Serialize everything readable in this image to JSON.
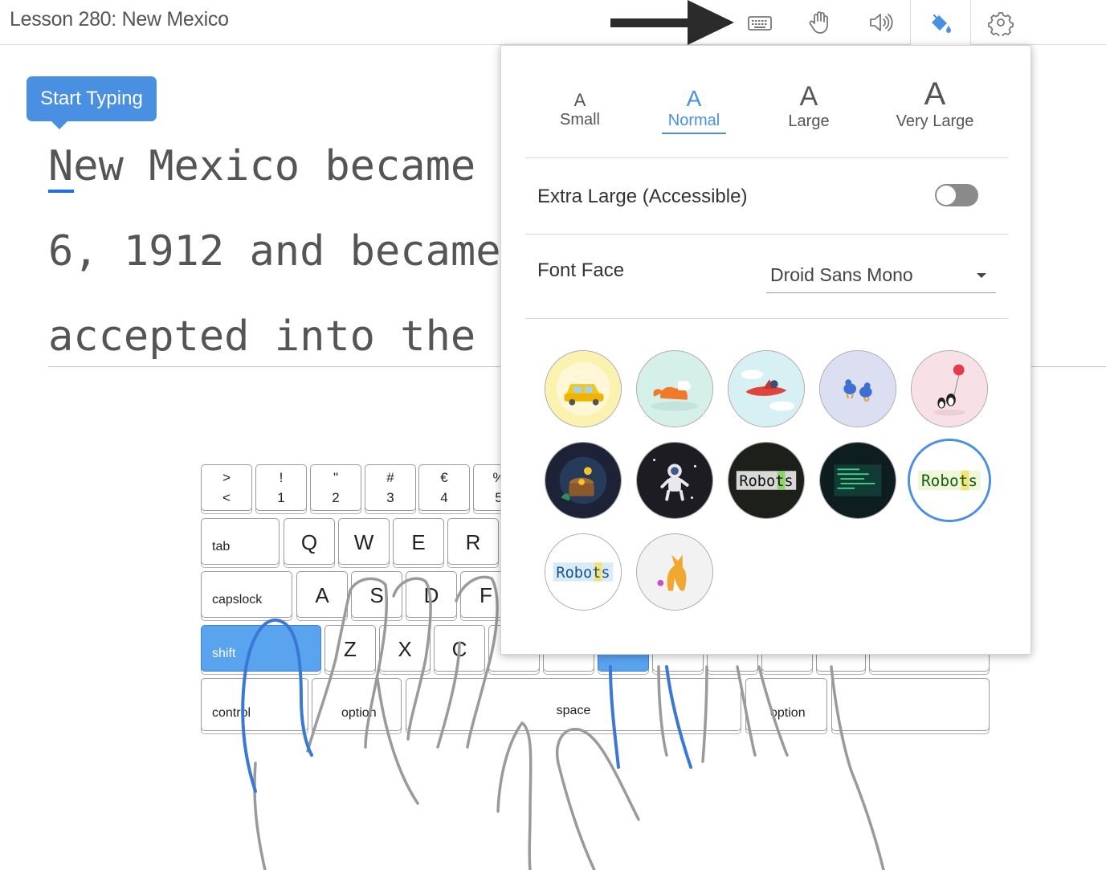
{
  "header": {
    "lesson_title": "Lesson 280: New Mexico",
    "toolbar": [
      {
        "id": "keyboard",
        "icon": "keyboard-icon"
      },
      {
        "id": "hands",
        "icon": "hand-icon"
      },
      {
        "id": "sound",
        "icon": "speaker-icon"
      },
      {
        "id": "theme",
        "icon": "paint-bucket-icon",
        "active": true
      },
      {
        "id": "settings",
        "icon": "gear-icon"
      }
    ]
  },
  "lesson": {
    "start_label": "Start Typing",
    "lines": [
      "New Mexico became",
      "6, 1912 and became",
      "accepted into the"
    ]
  },
  "keyboard": {
    "row_numbers": [
      {
        "top": ">",
        "bottom": "<"
      },
      {
        "top": "!",
        "bottom": "1"
      },
      {
        "top": "\"",
        "bottom": "2"
      },
      {
        "top": "#",
        "bottom": "3"
      },
      {
        "top": "€",
        "bottom": "4"
      },
      {
        "top": "%",
        "bottom": "5"
      }
    ],
    "tab": "tab",
    "row_top": [
      "Q",
      "W",
      "E",
      "R"
    ],
    "capslock": "capslock",
    "row_home": [
      "A",
      "S",
      "D",
      "F"
    ],
    "shift": "shift",
    "row_bottom": [
      "Z",
      "X",
      "C"
    ],
    "control": "control",
    "option_left": "option",
    "space": "space",
    "option_right": "option"
  },
  "popup": {
    "sizes": [
      {
        "glyph": "A",
        "label": "Small"
      },
      {
        "glyph": "A",
        "label": "Normal"
      },
      {
        "glyph": "A",
        "label": "Large"
      },
      {
        "glyph": "A",
        "label": "Very Large"
      }
    ],
    "selected_size": "Normal",
    "extra_large_label": "Extra Large (Accessible)",
    "extra_large_enabled": false,
    "font_face_label": "Font Face",
    "font_face_value": "Droid Sans Mono",
    "themes": [
      {
        "name": "taxi-theme",
        "color": "#fbf2b0"
      },
      {
        "name": "fox-theme",
        "color": "#d5efe9"
      },
      {
        "name": "airplane-theme",
        "color": "#d6f0f4"
      },
      {
        "name": "birds-theme",
        "color": "#dcdff1"
      },
      {
        "name": "penguins-theme",
        "color": "#f7e1e6"
      },
      {
        "name": "treasure-theme",
        "color": "#1d2236"
      },
      {
        "name": "astronaut-theme",
        "color": "#1c1c22"
      },
      {
        "name": "robots-dark-theme",
        "color": "#1c1f1a",
        "text": "Robots"
      },
      {
        "name": "code-theme",
        "color": "#0e1d1f"
      },
      {
        "name": "robots-light-theme",
        "color": "#ffffff",
        "text": "Robots",
        "selected": true
      },
      {
        "name": "robots-blue-theme",
        "color": "#ffffff",
        "text": "Robots"
      },
      {
        "name": "corgi-theme",
        "color": "#f2f2f2"
      }
    ]
  },
  "colors": {
    "accent": "#4a90e2",
    "shift_active": "#5aa3ef",
    "finger_highlight": "#3b78d6"
  }
}
